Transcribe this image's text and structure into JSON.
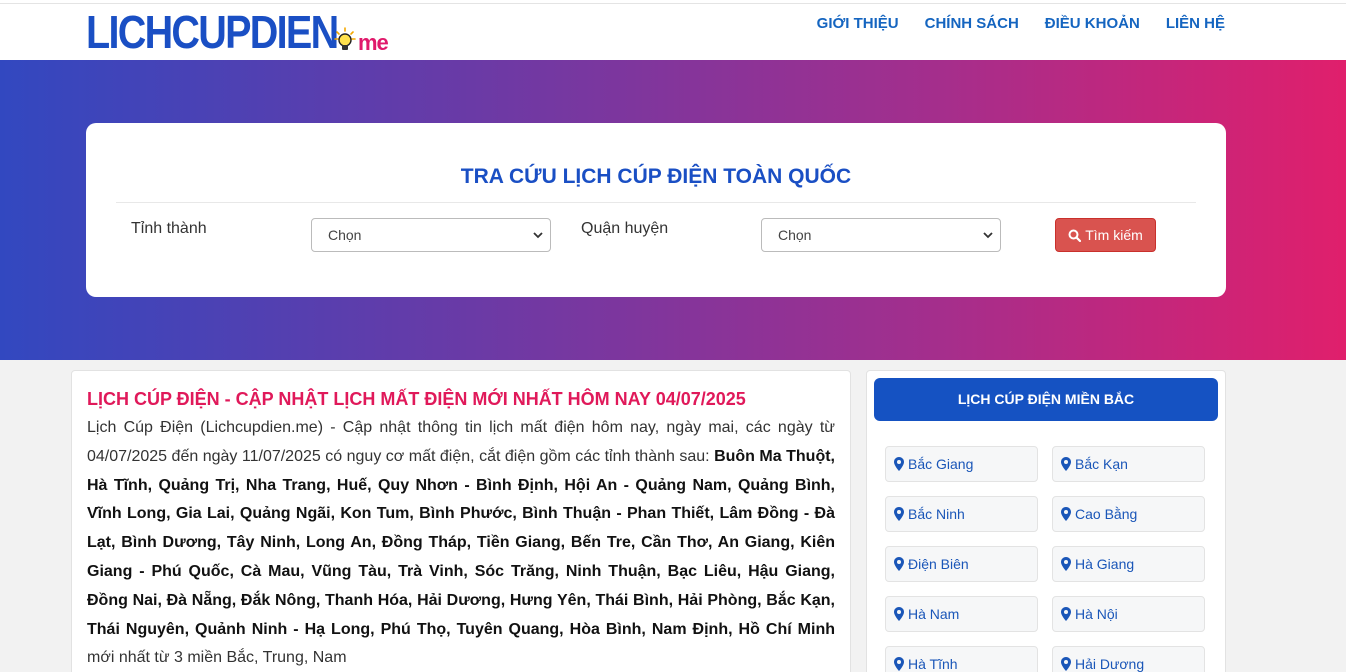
{
  "brand": {
    "name": "LICHCUPDIEN",
    "suffix": "me"
  },
  "nav": {
    "items": [
      "GIỚI THIỆU",
      "CHÍNH SÁCH",
      "ĐIỀU KHOẢN",
      "LIÊN HỆ"
    ]
  },
  "search": {
    "title": "TRA CỨU LỊCH CÚP ĐIỆN TOÀN QUỐC",
    "province_label": "Tỉnh thành",
    "province_value": "Chọn",
    "district_label": "Quận huyện",
    "district_value": "Chọn",
    "button_label": "Tìm kiếm"
  },
  "main": {
    "title": "LỊCH CÚP ĐIỆN - CẬP NHẬT LỊCH MẤT ĐIỆN MỚI NHẤT HÔM NAY 04/07/2025",
    "intro": "Lịch Cúp Điện (Lichcupdien.me) - Cập nhật thông tin lịch mất điện hôm nay, ngày mai, các ngày từ 04/07/2025 đến ngày 11/07/2025 có nguy cơ mất điện, cắt điện gồm các tỉnh thành sau: ",
    "provinces_bold": "Buôn Ma Thuột, Hà Tĩnh, Quảng Trị, Nha Trang, Huế, Quy Nhơn - Bình Định, Hội An - Quảng Nam, Quảng Bình, Vĩnh Long, Gia Lai, Quảng Ngãi, Kon Tum, Bình Phước, Bình Thuận - Phan Thiết, Lâm Đồng - Đà Lạt, Bình Dương, Tây Ninh, Long An, Đồng Tháp, Tiền Giang, Bến Tre, Cần Thơ, An Giang, Kiên Giang - Phú Quốc, Cà Mau, Vũng Tàu, Trà Vinh, Sóc Trăng, Ninh Thuận, Bạc Liêu, Hậu Giang, Đồng Nai, Đà Nẵng, Đắk Nông, Thanh Hóa, Hải Dương, Hưng Yên, Thái Bình, Hải Phòng, Bắc Kạn, Thái Nguyên, Quảnh Ninh - Hạ Long, Phú Thọ, Tuyên Quang, Hòa Bình, Nam Định, Hồ Chí Minh",
    "outro": " mới nhất từ 3 miền Bắc, Trung, Nam"
  },
  "sidebar": {
    "title": "LỊCH CÚP ĐIỆN MIỀN BẮC",
    "provinces": [
      "Bắc Giang",
      "Bắc Kạn",
      "Bắc Ninh",
      "Cao Bằng",
      "Điện Biên",
      "Hà Giang",
      "Hà Nam",
      "Hà Nội",
      "Hà Tĩnh",
      "Hải Dương"
    ]
  },
  "colors": {
    "brand_blue": "#1a4fc4",
    "brand_pink": "#e0196b",
    "hero_gradient_start": "#3248c0",
    "hero_gradient_end": "#e01f6c",
    "search_button": "#d9534f",
    "title_red": "#e0195a",
    "sidebar_header": "#1552c2"
  },
  "icons": {
    "search_button": "search-icon",
    "province_item": "map-marker-icon",
    "select_arrow": "chevron-down-icon",
    "logo": "lightbulb-icon"
  }
}
